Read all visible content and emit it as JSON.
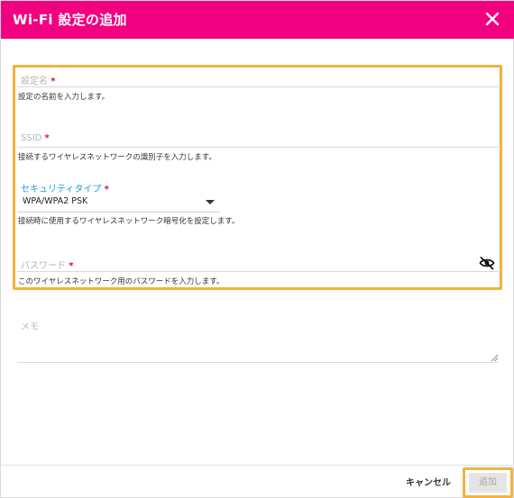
{
  "dialog": {
    "title": "Wi-Fi 設定の追加",
    "header_color": "#f2007f",
    "highlight_color": "#f3b23c"
  },
  "fields": {
    "name": {
      "label": "設定名",
      "required_mark": "*",
      "help": "設定の名前を入力します。"
    },
    "ssid": {
      "label": "SSID",
      "required_mark": "*",
      "help": "接続するワイヤレスネットワークの識別子を入力します。"
    },
    "security": {
      "label": "セキュリティタイプ",
      "required_mark": "*",
      "value": "WPA/WPA2 PSK",
      "help": "接続時に使用するワイヤレスネットワーク暗号化を設定します。"
    },
    "password": {
      "label": "パスワード",
      "required_mark": "*",
      "help": "このワイヤレスネットワーク用のパスワードを入力します。",
      "toggle_icon": "eye-slash-icon"
    },
    "memo": {
      "label": "メモ"
    }
  },
  "footer": {
    "cancel_label": "キャンセル",
    "add_label": "追加"
  }
}
